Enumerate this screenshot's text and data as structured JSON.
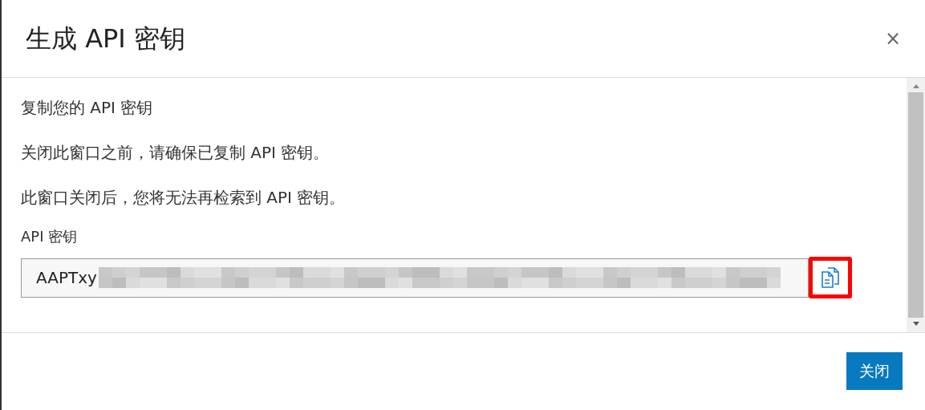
{
  "dialog": {
    "title": "生成 API 密钥",
    "close": "×"
  },
  "body": {
    "heading": "复制您的 API 密钥",
    "paragraphs": [
      "关闭此窗口之前，请确保已复制 API 密钥。",
      "此窗口关闭后，您将无法再检索到 API 密钥。"
    ],
    "field": {
      "label": "API 密钥",
      "value": "AAPTxy",
      "redacted": true,
      "copy_highlighted": true
    }
  },
  "buttons": [
    {
      "label": "关闭"
    }
  ]
}
